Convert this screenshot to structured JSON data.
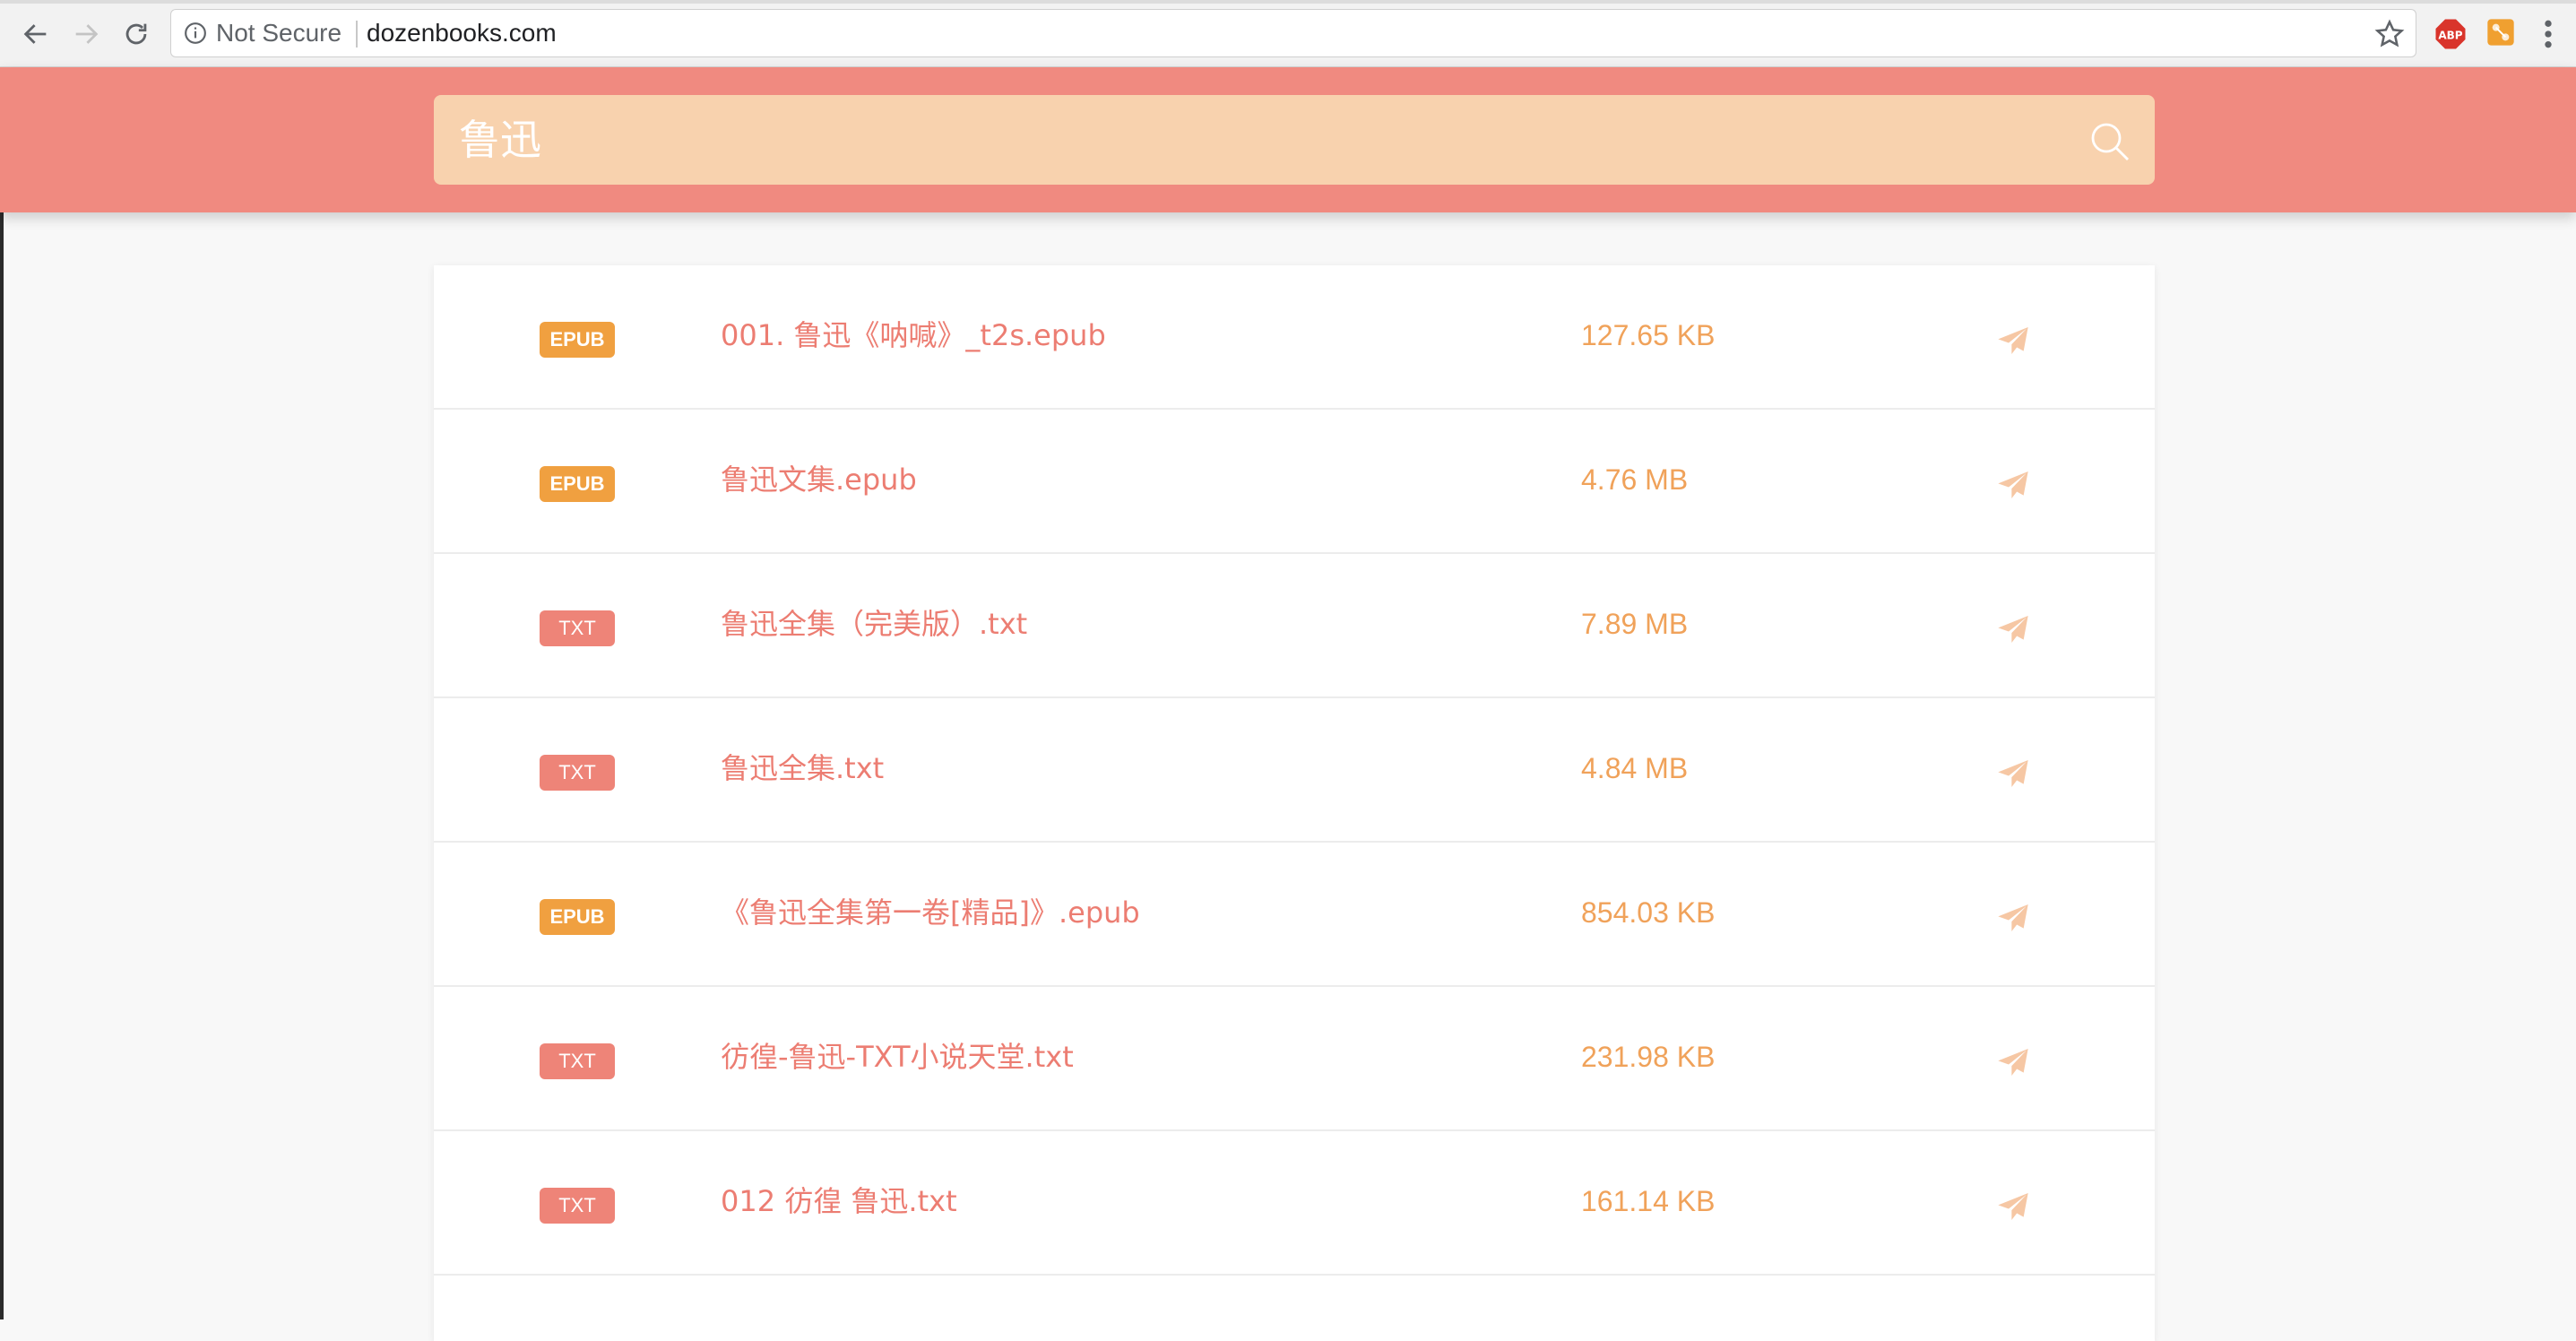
{
  "browser": {
    "security_label": "Not Secure",
    "url": "dozenbooks.com"
  },
  "search": {
    "query": "鲁迅"
  },
  "colors": {
    "header": "#f08a80",
    "search_box": "#f8d2ae",
    "epub_badge": "#f0a040",
    "txt_badge": "#ee8478",
    "name_text": "#ec7d72",
    "size_text": "#f0a25a",
    "send_icon": "#f6c7a4"
  },
  "results": [
    {
      "format": "EPUB",
      "name": "001. 鲁迅《呐喊》_t2s.epub",
      "size": "127.65 KB",
      "icon": "send-icon"
    },
    {
      "format": "EPUB",
      "name": "鲁迅文集.epub",
      "size": "4.76 MB",
      "icon": "send-icon"
    },
    {
      "format": "TXT",
      "name": "鲁迅全集（完美版）.txt",
      "size": "7.89 MB",
      "icon": "send-icon"
    },
    {
      "format": "TXT",
      "name": "鲁迅全集.txt",
      "size": "4.84 MB",
      "icon": "send-icon"
    },
    {
      "format": "EPUB",
      "name": "《鲁迅全集第一卷[精品]》.epub",
      "size": "854.03 KB",
      "icon": "send-icon"
    },
    {
      "format": "TXT",
      "name": "彷徨-鲁迅-TXT小说天堂.txt",
      "size": "231.98 KB",
      "icon": "send-icon"
    },
    {
      "format": "TXT",
      "name": "012 彷徨 鲁迅.txt",
      "size": "161.14 KB",
      "icon": "send-icon"
    }
  ]
}
